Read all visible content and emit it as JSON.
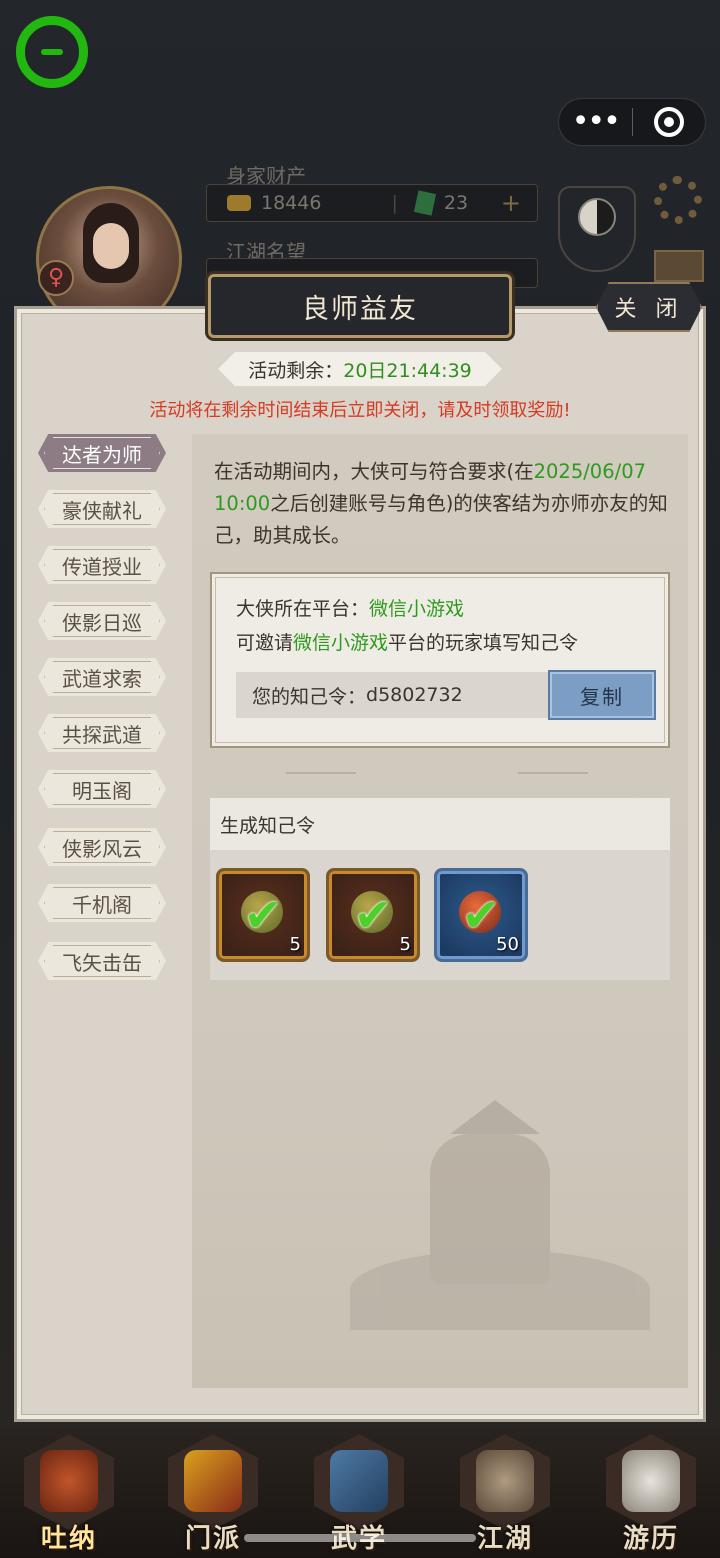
{
  "hud": {
    "wealth_label": "身家财产",
    "gold": "18446",
    "jade": "23",
    "plus": "+",
    "fame_label": "江湖名望",
    "more_dots": "•••"
  },
  "panel": {
    "title": "良师益友",
    "close_label": "关 闭",
    "timer_label": "活动剩余：",
    "timer_value": "20日21:44:39",
    "warning": "活动将在剩余时间结束后立即关闭，请及时领取奖励!"
  },
  "tabs": [
    {
      "label": "达者为师",
      "active": true
    },
    {
      "label": "豪侠献礼",
      "active": false
    },
    {
      "label": "传道授业",
      "active": false
    },
    {
      "label": "侠影日巡",
      "active": false
    },
    {
      "label": "武道求索",
      "active": false
    },
    {
      "label": "共探武道",
      "active": false
    },
    {
      "label": "明玉阁",
      "active": false
    },
    {
      "label": "侠影风云",
      "active": false
    },
    {
      "label": "千机阁",
      "active": false
    },
    {
      "label": "飞矢击缶",
      "active": false
    }
  ],
  "intro": {
    "part1": "在活动期间内，大侠可与符合要求(在",
    "date": "2025/06/07 10:00",
    "part2": "之后创建账号与角色)的侠客结为亦师亦友的知己，助其成长。"
  },
  "invite": {
    "platform_label": "大侠所在平台：",
    "platform": "微信小游戏",
    "invite_prefix": "可邀请",
    "invite_platform": "微信小游戏",
    "invite_suffix": "平台的玩家填写知己令",
    "code_label": "您的知己令：",
    "code": "d5802732",
    "copy_label": "复制"
  },
  "rewards": {
    "title": "生成知己令",
    "items": [
      {
        "icon": "gold-orb-icon",
        "qty": "5",
        "rarity": "orange"
      },
      {
        "icon": "book-orb-icon",
        "qty": "5",
        "rarity": "orange"
      },
      {
        "icon": "red-orb-icon",
        "qty": "50",
        "rarity": "blue"
      }
    ]
  },
  "bottom_nav": [
    {
      "label": "吐纳"
    },
    {
      "label": "门派"
    },
    {
      "label": "武学"
    },
    {
      "label": "江湖"
    },
    {
      "label": "游历"
    }
  ],
  "colors": {
    "accent_green": "#2f9a1d",
    "warning_red": "#d63a22",
    "copy_button": "#7c9dc4",
    "active_tab": "#8d7c83"
  }
}
